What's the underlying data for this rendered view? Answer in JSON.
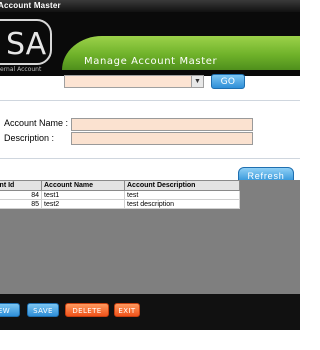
{
  "window": {
    "title": "Account Master"
  },
  "banner": {
    "logo_letters": "SA",
    "logo_caption": "ernal Account",
    "title": "Manage Account Master"
  },
  "search": {
    "selected_value": "",
    "go_label": "GO"
  },
  "form": {
    "account_name_label": "Account Name :",
    "description_label": "Description :",
    "account_name_value": "",
    "description_value": ""
  },
  "grid": {
    "refresh_label": "Refresh",
    "columns": [
      "ount Id",
      "Account Name",
      "Account Description"
    ],
    "rows": [
      [
        "84",
        "test1",
        "test"
      ],
      [
        "85",
        "test2",
        "test description"
      ]
    ]
  },
  "actions": {
    "new_label": "EW",
    "save_label": "SAVE",
    "delete_label": "DELETE",
    "exit_label": "EXIT"
  },
  "colors": {
    "accent_green": "#6fb22a",
    "button_blue": "#2f8fd8",
    "button_orange": "#f0531b",
    "input_fill": "#fbe2d0"
  }
}
